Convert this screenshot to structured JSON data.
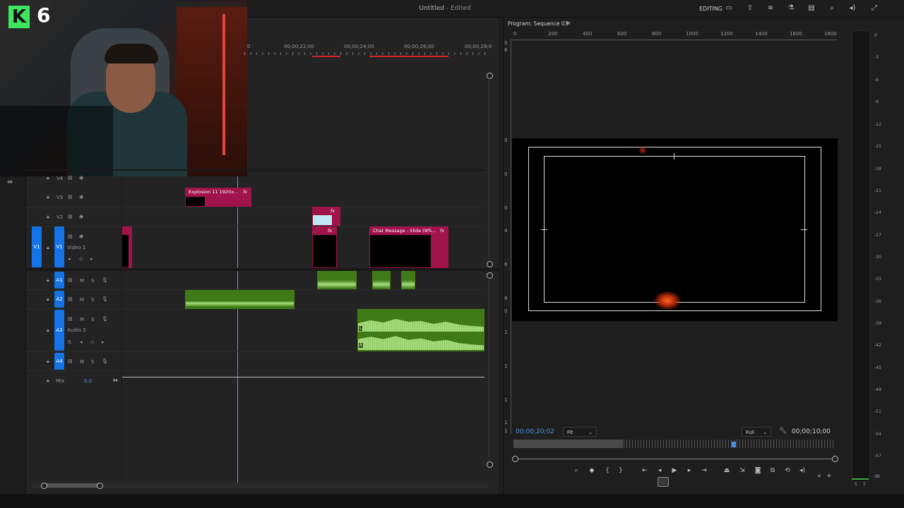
{
  "window": {
    "title": "Untitled",
    "title_suffix": "- Edited",
    "workspace": "EDITING"
  },
  "badge": {
    "letter": "K",
    "number": "6"
  },
  "timeline": {
    "timecodes": [
      "0",
      "00;00;22;00",
      "00;00;24;00",
      "00;00;26;00",
      "00;00;28;0"
    ],
    "tracks": {
      "v4": {
        "label": "V4"
      },
      "v3": {
        "label": "V3"
      },
      "v2": {
        "label": "V2"
      },
      "v1": {
        "label": "V1",
        "source": "V1",
        "name": "Video 1"
      },
      "a1": {
        "label": "A1",
        "m": "M",
        "s": "S"
      },
      "a2": {
        "label": "A2",
        "m": "M",
        "s": "S"
      },
      "a3": {
        "label": "A3",
        "m": "M",
        "s": "S",
        "name": "Audio 3",
        "vol": "0."
      },
      "a4": {
        "label": "A4",
        "m": "M",
        "s": "S"
      },
      "mix": {
        "label": "Mix",
        "value": "0.0"
      }
    },
    "clips": {
      "explosion": {
        "label": "Explosion 11 1920x...",
        "fx": "fx"
      },
      "chat": {
        "label": "Chat Message - Slide (9fS...",
        "fx": "fx"
      },
      "v2_fx": "fx",
      "v1_fx": "fx",
      "audio_r": "R",
      "audio_l": "L"
    }
  },
  "program": {
    "title": "Program: Sequence 03",
    "ruler": [
      "0",
      "200",
      "400",
      "600",
      "800",
      "1000",
      "1200",
      "1400",
      "1600",
      "1800"
    ],
    "left_ruler": [
      "0",
      "6",
      "0",
      "0",
      "0",
      "4",
      "6",
      "8",
      "0",
      "1",
      "1",
      "1",
      "1",
      "1"
    ],
    "timecode_current": "00;00;20;02",
    "zoom": "Fit",
    "quality": "Full",
    "timecode_duration": "00;00;10;00"
  },
  "meter": {
    "levels": [
      "0",
      "-3",
      "-6",
      "-9",
      "-12",
      "-15",
      "-18",
      "-21",
      "-24",
      "-27",
      "-30",
      "-33",
      "-36",
      "-39",
      "-42",
      "-45",
      "-48",
      "-51",
      "-54",
      "-57",
      "dB"
    ],
    "solo": [
      "S",
      "S"
    ]
  },
  "colors": {
    "accent": "#1473e6",
    "video_clip": "#a0134b",
    "audio_clip": "#3f7a16",
    "waveform": "#a7dc7d"
  }
}
